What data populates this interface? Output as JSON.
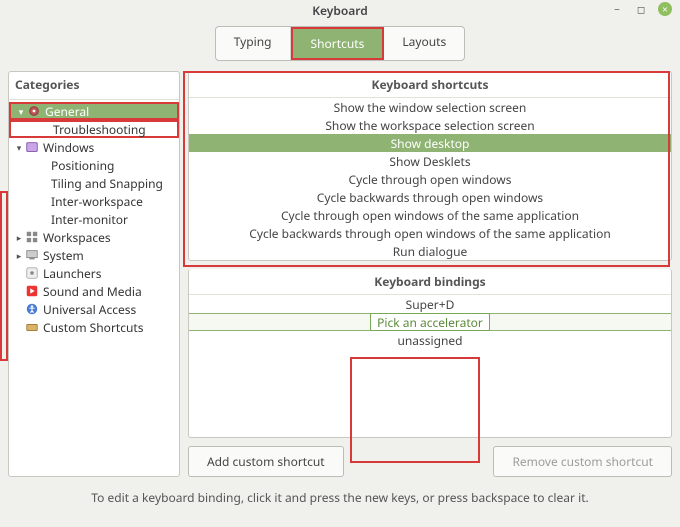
{
  "window": {
    "title": "Keyboard",
    "minimize_icon": "−",
    "maximize_icon": "◻",
    "close_icon": "×"
  },
  "tabs": {
    "items": [
      {
        "label": "Typing",
        "active": false
      },
      {
        "label": "Shortcuts",
        "active": true
      },
      {
        "label": "Layouts",
        "active": false
      }
    ]
  },
  "categories": {
    "title": "Categories",
    "tree": [
      {
        "label": "General",
        "depth": 0,
        "exp": true,
        "icon": "gear",
        "sel": true,
        "hl": true
      },
      {
        "label": "Troubleshooting",
        "depth": 2,
        "hl": true
      },
      {
        "label": "Windows",
        "depth": 0,
        "exp": true,
        "icon": "windows"
      },
      {
        "label": "Positioning",
        "depth": 2
      },
      {
        "label": "Tiling and Snapping",
        "depth": 2
      },
      {
        "label": "Inter-workspace",
        "depth": 2
      },
      {
        "label": "Inter-monitor",
        "depth": 2
      },
      {
        "label": "Workspaces",
        "depth": 0,
        "exp": false,
        "icon": "workspaces"
      },
      {
        "label": "System",
        "depth": 0,
        "exp": false,
        "icon": "system"
      },
      {
        "label": "Launchers",
        "depth": 0,
        "icon": "launchers"
      },
      {
        "label": "Sound and Media",
        "depth": 0,
        "icon": "sound"
      },
      {
        "label": "Universal Access",
        "depth": 0,
        "icon": "access"
      },
      {
        "label": "Custom Shortcuts",
        "depth": 0,
        "icon": "custom"
      }
    ]
  },
  "shortcuts": {
    "title": "Keyboard shortcuts",
    "items": [
      {
        "label": "Show the window selection screen"
      },
      {
        "label": "Show the workspace selection screen"
      },
      {
        "label": "Show desktop",
        "sel": true
      },
      {
        "label": "Show Desklets"
      },
      {
        "label": "Cycle through open windows"
      },
      {
        "label": "Cycle backwards through open windows"
      },
      {
        "label": "Cycle through open windows of the same application"
      },
      {
        "label": "Cycle backwards through open windows of the same application"
      },
      {
        "label": "Run dialogue"
      }
    ]
  },
  "bindings": {
    "title": "Keyboard bindings",
    "items": [
      {
        "label": "Super+D"
      },
      {
        "label": "Pick an accelerator",
        "pick": true
      },
      {
        "label": "unassigned"
      }
    ]
  },
  "buttons": {
    "add": "Add custom shortcut",
    "remove": "Remove custom shortcut"
  },
  "footer": {
    "hint": "To edit a keyboard binding, click it and press the new keys, or press backspace to clear it."
  },
  "colors": {
    "accent": "#8eb373",
    "annotation": "#d83a3a"
  }
}
